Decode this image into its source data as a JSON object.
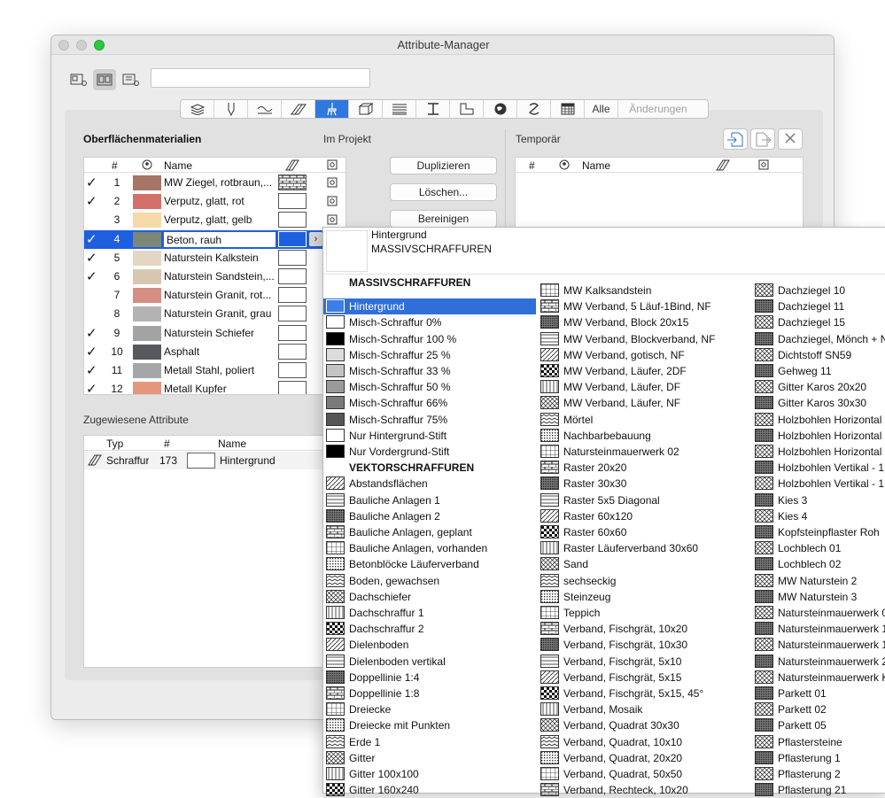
{
  "window": {
    "title": "Attribute-Manager"
  },
  "search": {
    "placeholder": ""
  },
  "tabs": {
    "all_label": "Alle",
    "changes_label": "Änderungen"
  },
  "left": {
    "title": "Oberflächenmaterialien",
    "in_project": "Im Projekt",
    "col_num": "#",
    "col_name": "Name"
  },
  "rows": [
    {
      "check": "✓",
      "num": "1",
      "name": "MW Ziegel, rotbraun,...",
      "color": "#a67565"
    },
    {
      "check": "✓",
      "num": "2",
      "name": "Verputz, glatt, rot",
      "color": "#d4706a"
    },
    {
      "check": "",
      "num": "3",
      "name": "Verputz, glatt, gelb",
      "color": "#f6d8a9"
    },
    {
      "check": "✓",
      "num": "4",
      "name": "Beton, rauh",
      "color": "#7d8778"
    },
    {
      "check": "✓",
      "num": "5",
      "name": "Naturstein Kalkstein",
      "color": "#e3d6c2"
    },
    {
      "check": "✓",
      "num": "6",
      "name": "Naturstein Sandstein,...",
      "color": "#d7c7b1"
    },
    {
      "check": "",
      "num": "7",
      "name": "Naturstein Granit, rot...",
      "color": "#d58e82"
    },
    {
      "check": "",
      "num": "8",
      "name": "Naturstein Granit, grau",
      "color": "#b3b3b3"
    },
    {
      "check": "✓",
      "num": "9",
      "name": "Naturstein Schiefer",
      "color": "#a2a3a5"
    },
    {
      "check": "✓",
      "num": "10",
      "name": "Asphalt",
      "color": "#565a5f"
    },
    {
      "check": "✓",
      "num": "11",
      "name": "Metall Stahl, poliert",
      "color": "#a4a6a8"
    },
    {
      "check": "✓",
      "num": "12",
      "name": "Metall Kupfer",
      "color": "#e4977d"
    }
  ],
  "buttons": {
    "duplicate": "Duplizieren",
    "delete": "Löschen...",
    "clean": "Bereinigen"
  },
  "temp": {
    "title": "Temporär",
    "col_num": "#",
    "col_name": "Name"
  },
  "assigned": {
    "title": "Zugewiesene Attribute",
    "col_type": "Typ",
    "col_num": "#",
    "col_name": "Name",
    "row": {
      "type": "Schraffur",
      "num": "173",
      "name": "Hintergrund"
    }
  },
  "popup": {
    "preview_title": "Hintergrund",
    "preview_sub": "MASSIVSCHRAFFUREN",
    "col1_header1": "MASSIVSCHRAFFUREN",
    "col1_header2": "VEKTORSCHRAFFUREN",
    "col1a": [
      "Hintergrund",
      "Misch-Schraffur 0%",
      "Misch-Schraffur 100 %",
      "Misch-Schraffur 25 %",
      "Misch-Schraffur 33 %",
      "Misch-Schraffur 50 %",
      "Misch-Schraffur 66%",
      "Misch-Schraffur 75%",
      "Nur Hintergrund-Stift",
      "Nur Vordergrund-Stift"
    ],
    "col1b": [
      "Abstandsflächen",
      "Bauliche Anlagen 1",
      "Bauliche Anlagen 2",
      "Bauliche Anlagen, geplant",
      "Bauliche Anlagen, vorhanden",
      "Betonblöcke Läuferverband",
      "Boden, gewachsen",
      "Dachschiefer",
      "Dachschraffur 1",
      "Dachschraffur 2",
      "Dielenboden",
      "Dielenboden vertikal",
      "Doppellinie 1:4",
      "Doppellinie 1:8",
      "Dreiecke",
      "Dreiecke mit Punkten",
      "Erde 1",
      "Gitter",
      "Gitter 100x100",
      "Gitter 160x240"
    ],
    "col2": [
      "MW Kalksandstein",
      "MW Verband, 5 Läuf-1Bind, NF",
      "MW Verband, Block 20x15",
      "MW Verband, Blockverband, NF",
      "MW Verband, gotisch, NF",
      "MW Verband, Läufer, 2DF",
      "MW Verband, Läufer, DF",
      "MW Verband, Läufer, NF",
      "Mörtel",
      "Nachbarbebauung",
      "Natursteinmauerwerk 02",
      "Raster 20x20",
      "Raster 30x30",
      "Raster 5x5 Diagonal",
      "Raster 60x120",
      "Raster 60x60",
      "Raster Läuferverband 30x60",
      "Sand",
      "sechseckig",
      "Steinzeug",
      "Teppich",
      "Verband, Fischgrät, 10x20",
      "Verband, Fischgrät, 10x30",
      "Verband, Fischgrät, 5x10",
      "Verband, Fischgrät, 5x15",
      "Verband, Fischgrät, 5x15, 45°",
      "Verband, Mosaik",
      "Verband, Quadrat 30x30",
      "Verband, Quadrat, 10x10",
      "Verband, Quadrat, 20x20",
      "Verband, Quadrat, 50x50",
      "Verband, Rechteck, 10x20"
    ],
    "col3": [
      "Dachziegel 10",
      "Dachziegel 11",
      "Dachziegel 15",
      "Dachziegel, Mönch + N",
      "Dichtstoff SN59",
      "Gehweg 11",
      "Gitter Karos 20x20",
      "Gitter Karos 30x30",
      "Holzbohlen Horizontal",
      "Holzbohlen Horizontal",
      "Holzbohlen Horizontal",
      "Holzbohlen Vertikal - 1",
      "Holzbohlen Vertikal - 1",
      "Kies 3",
      "Kies 4",
      "Kopfsteinpflaster Roh",
      "Lochblech 01",
      "Lochblech 02",
      "MW Naturstein 2",
      "MW Naturstein 3",
      "Natursteinmauerwerk 0",
      "Natursteinmauerwerk 1",
      "Natursteinmauerwerk 1",
      "Natursteinmauerwerk 2",
      "Natursteinmauerwerk K",
      "Parkett 01",
      "Parkett 02",
      "Parkett 05",
      "Pflastersteine",
      "Pflasterung 1",
      "Pflasterung 2",
      "Pflasterung 21"
    ]
  },
  "colors": {
    "accent": "#1e5fe0",
    "tab_selected": "#2f78e0"
  }
}
